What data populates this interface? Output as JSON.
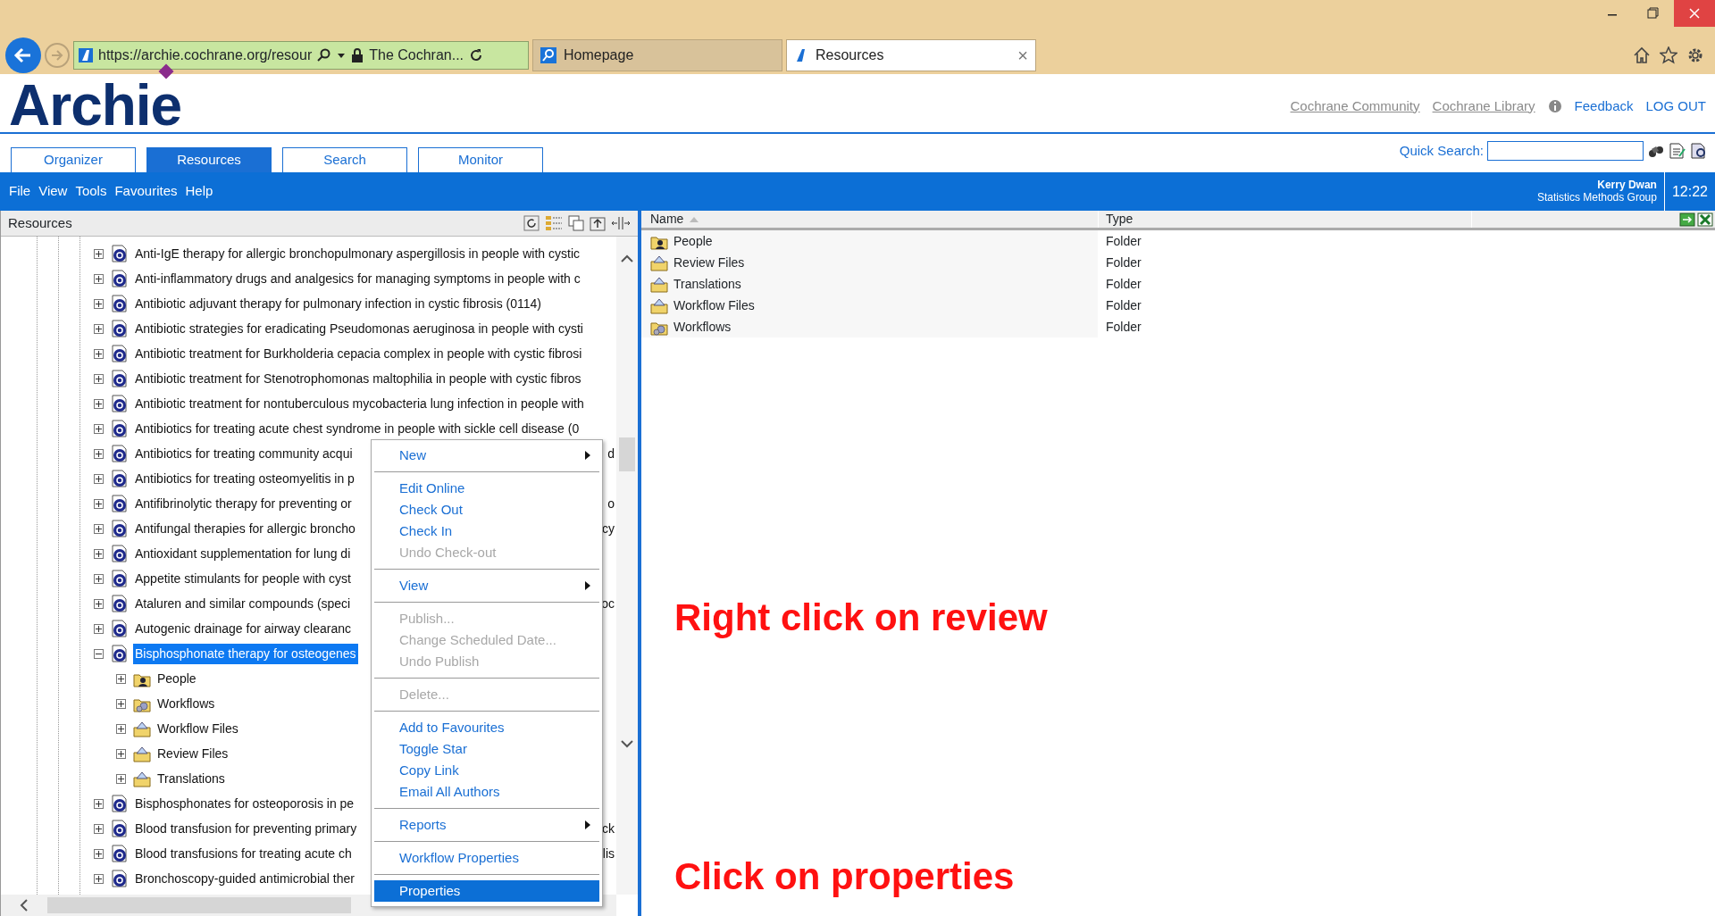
{
  "browser": {
    "address": "https://archie.cochrane.org/resour",
    "site_title": "The Cochran...",
    "tabs": [
      {
        "label": "Homepage",
        "selected": false,
        "closable": false
      },
      {
        "label": "Resources",
        "selected": true,
        "closable": true
      }
    ],
    "close_glyph": "×"
  },
  "header": {
    "logo": "Archie",
    "links": [
      {
        "label": "Cochrane Community",
        "kind": "muted"
      },
      {
        "label": "Cochrane Library",
        "kind": "muted-info"
      },
      {
        "label": "Feedback",
        "kind": "primary"
      },
      {
        "label": "LOG OUT",
        "kind": "primary"
      }
    ]
  },
  "tabs": [
    {
      "label": "Organizer",
      "selected": false
    },
    {
      "label": "Resources",
      "selected": true
    },
    {
      "label": "Search",
      "selected": false
    },
    {
      "label": "Monitor",
      "selected": false
    }
  ],
  "quick_search": {
    "label": "Quick Search:"
  },
  "menu_bar": {
    "items": [
      "File",
      "View",
      "Tools",
      "Favourites",
      "Help"
    ],
    "user_name": "Kerry Dwan",
    "user_group": "Statistics Methods Group",
    "time": "12:22"
  },
  "tree": {
    "title": "Resources",
    "items": [
      {
        "label": "Anti-IgE therapy for allergic bronchopulmonary aspergillosis in people with cystic",
        "kind": "review",
        "expanded": false,
        "selected": false
      },
      {
        "label": "Anti-inflammatory drugs and analgesics for managing symptoms in people with c",
        "kind": "review",
        "expanded": false,
        "selected": false
      },
      {
        "label": "Antibiotic adjuvant therapy for pulmonary infection in cystic fibrosis (0114)",
        "kind": "review",
        "expanded": false,
        "selected": false
      },
      {
        "label": "Antibiotic strategies for eradicating Pseudomonas aeruginosa in people with cysti",
        "kind": "review",
        "expanded": false,
        "selected": false
      },
      {
        "label": "Antibiotic treatment for Burkholderia cepacia complex in people with cystic fibrosi",
        "kind": "review",
        "expanded": false,
        "selected": false
      },
      {
        "label": "Antibiotic treatment for Stenotrophomonas maltophilia in people with cystic fibros",
        "kind": "review",
        "expanded": false,
        "selected": false
      },
      {
        "label": "Antibiotic treatment for nontuberculous mycobacteria lung infection in people with",
        "kind": "review",
        "expanded": false,
        "selected": false
      },
      {
        "label": "Antibiotics for treating acute chest syndrome in people with sickle cell disease (0",
        "kind": "review",
        "expanded": false,
        "selected": false
      },
      {
        "label": "Antibiotics for treating community acqui",
        "tail": "d",
        "kind": "review",
        "expanded": false,
        "selected": false
      },
      {
        "label": "Antibiotics for treating osteomyelitis in p",
        "kind": "review",
        "expanded": false,
        "selected": false
      },
      {
        "label": "Antifibrinolytic therapy for preventing or",
        "tail": "o",
        "kind": "review",
        "expanded": false,
        "selected": false
      },
      {
        "label": "Antifungal therapies for allergic broncho",
        "tail": "cy",
        "kind": "review",
        "expanded": false,
        "selected": false
      },
      {
        "label": "Antioxidant supplementation for lung di",
        "kind": "review",
        "expanded": false,
        "selected": false
      },
      {
        "label": "Appetite stimulants for people with cyst",
        "kind": "review",
        "expanded": false,
        "selected": false
      },
      {
        "label": "Ataluren and similar compounds (speci",
        "tail": "oc",
        "kind": "review",
        "expanded": false,
        "selected": false
      },
      {
        "label": "Autogenic drainage for airway clearanc",
        "kind": "review",
        "expanded": false,
        "selected": false
      },
      {
        "label": "Bisphosphonate therapy for osteogenes",
        "kind": "review",
        "expanded": true,
        "selected": true,
        "children": [
          {
            "label": "People",
            "kind": "people",
            "expanded": false,
            "selected": false
          },
          {
            "label": "Workflows",
            "kind": "workflows",
            "expanded": false,
            "selected": false
          },
          {
            "label": "Workflow Files",
            "kind": "files",
            "expanded": false,
            "selected": false
          },
          {
            "label": "Review Files",
            "kind": "files",
            "expanded": false,
            "selected": false
          },
          {
            "label": "Translations",
            "kind": "files",
            "expanded": false,
            "selected": false
          }
        ]
      },
      {
        "label": "Bisphosphonates for osteoporosis in pe",
        "kind": "review",
        "expanded": false,
        "selected": false
      },
      {
        "label": "Blood transfusion for preventing primary",
        "tail": "ck",
        "kind": "review",
        "expanded": false,
        "selected": false
      },
      {
        "label": "Blood transfusions for treating acute ch",
        "tail": "lis",
        "kind": "review",
        "expanded": false,
        "selected": false
      },
      {
        "label": "Bronchoscopy-guided antimicrobial ther",
        "kind": "review",
        "expanded": false,
        "selected": false
      }
    ]
  },
  "list": {
    "columns": [
      "Name",
      "Type"
    ],
    "rows": [
      {
        "name": "People",
        "type": "Folder",
        "kind": "people"
      },
      {
        "name": "Review Files",
        "type": "Folder",
        "kind": "files"
      },
      {
        "name": "Translations",
        "type": "Folder",
        "kind": "files"
      },
      {
        "name": "Workflow Files",
        "type": "Folder",
        "kind": "files"
      },
      {
        "name": "Workflows",
        "type": "Folder",
        "kind": "workflows"
      }
    ]
  },
  "context_menu": [
    {
      "kind": "item",
      "label": "New",
      "submenu": true,
      "disabled": false,
      "selected": false
    },
    {
      "kind": "separator"
    },
    {
      "kind": "item",
      "label": "Edit Online",
      "submenu": false,
      "disabled": false,
      "selected": false
    },
    {
      "kind": "item",
      "label": "Check Out",
      "submenu": false,
      "disabled": false,
      "selected": false
    },
    {
      "kind": "item",
      "label": "Check In",
      "submenu": false,
      "disabled": false,
      "selected": false
    },
    {
      "kind": "item",
      "label": "Undo Check-out",
      "submenu": false,
      "disabled": true,
      "selected": false
    },
    {
      "kind": "separator"
    },
    {
      "kind": "item",
      "label": "View",
      "submenu": true,
      "disabled": false,
      "selected": false
    },
    {
      "kind": "separator"
    },
    {
      "kind": "item",
      "label": "Publish...",
      "submenu": false,
      "disabled": true,
      "selected": false
    },
    {
      "kind": "item",
      "label": "Change Scheduled Date...",
      "submenu": false,
      "disabled": true,
      "selected": false
    },
    {
      "kind": "item",
      "label": "Undo Publish",
      "submenu": false,
      "disabled": true,
      "selected": false
    },
    {
      "kind": "separator"
    },
    {
      "kind": "item",
      "label": "Delete...",
      "submenu": false,
      "disabled": true,
      "selected": false
    },
    {
      "kind": "separator"
    },
    {
      "kind": "item",
      "label": "Add to Favourites",
      "submenu": false,
      "disabled": false,
      "selected": false
    },
    {
      "kind": "item",
      "label": "Toggle Star",
      "submenu": false,
      "disabled": false,
      "selected": false
    },
    {
      "kind": "item",
      "label": "Copy Link",
      "submenu": false,
      "disabled": false,
      "selected": false
    },
    {
      "kind": "item",
      "label": "Email All Authors",
      "submenu": false,
      "disabled": false,
      "selected": false
    },
    {
      "kind": "separator"
    },
    {
      "kind": "item",
      "label": "Reports",
      "submenu": true,
      "disabled": false,
      "selected": false
    },
    {
      "kind": "separator"
    },
    {
      "kind": "item",
      "label": "Workflow Properties",
      "submenu": false,
      "disabled": false,
      "selected": false
    },
    {
      "kind": "separator"
    },
    {
      "kind": "item",
      "label": "Properties",
      "submenu": false,
      "disabled": false,
      "selected": true
    }
  ],
  "annotations": [
    "Right click on review",
    "Click on properties"
  ]
}
